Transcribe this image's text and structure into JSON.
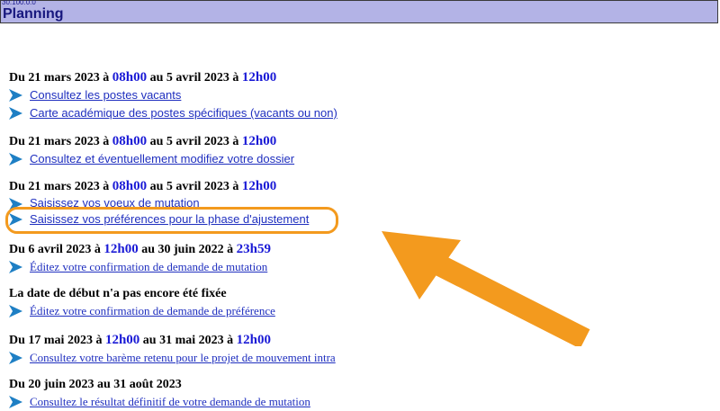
{
  "header": {
    "version": "30.100.0.0",
    "title": "Planning"
  },
  "sections": [
    {
      "title": {
        "pre": "Du 21 mars 2023 à ",
        "t1": "08h00",
        "mid": " au 5 avril 2023 à ",
        "t2": "12h00"
      },
      "links": [
        "Consultez les postes vacants",
        "Carte académique des postes spécifiques (vacants ou non)"
      ]
    },
    {
      "title": {
        "pre": "Du 21 mars 2023 à ",
        "t1": "08h00",
        "mid": " au 5 avril 2023 à ",
        "t2": "12h00"
      },
      "links": [
        "Consultez et éventuellement modifiez votre dossier"
      ]
    },
    {
      "title": {
        "pre": "Du 21 mars 2023 à ",
        "t1": "08h00",
        "mid": " au 5 avril 2023 à ",
        "t2": "12h00"
      },
      "links": [
        "Saisissez vos voeux de mutation",
        "Saisissez vos préférences pour la phase d'ajustement"
      ]
    },
    {
      "title": {
        "pre": "Du 6 avril 2023 à ",
        "t1": "12h00",
        "mid": " au 30 juin 2022 à ",
        "t2": "23h59"
      },
      "links": [
        "Éditez votre confirmation de demande de mutation"
      ]
    },
    {
      "title": {
        "pre": "La date de début n'a pas encore été fixée"
      },
      "links": [
        "Éditez votre confirmation de demande de préférence"
      ]
    },
    {
      "title": {
        "pre": "Du 17 mai 2023 à ",
        "t1": "12h00",
        "mid": " au 31 mai 2023 à ",
        "t2": "12h00"
      },
      "links": [
        "Consultez votre barème retenu pour le projet de mouvement intra"
      ]
    },
    {
      "title": {
        "pre": "Du 20 juin 2023 au 31 août 2023"
      },
      "links": [
        "Consultez le résultat définitif de votre demande de mutation"
      ]
    }
  ],
  "colors": {
    "accent_orange": "#f39a1e",
    "header_bg": "#b3b3e6",
    "arrow_blue": "#1e7fc4",
    "link": "#1f2fbf"
  },
  "icons": {
    "link_arrow": "play-arrow-icon",
    "annotation": "orange-pointer-arrow"
  }
}
